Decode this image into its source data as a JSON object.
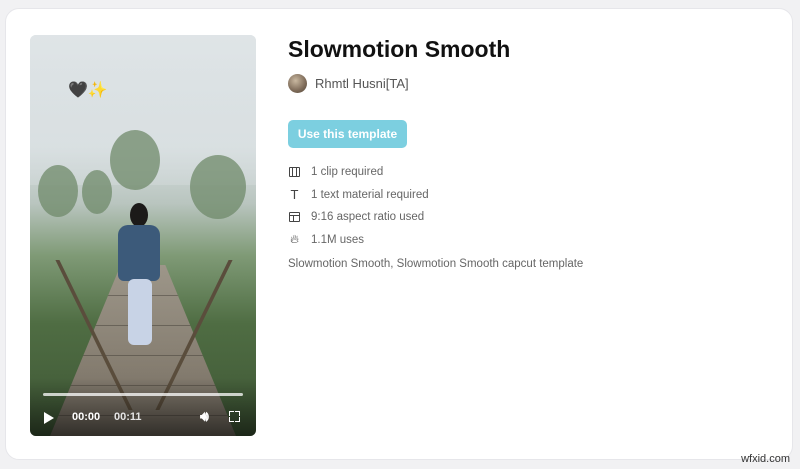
{
  "template": {
    "title": "Slowmotion Smooth",
    "author_name": "Rhmtl Husni[TA]",
    "use_button_label": "Use this template",
    "info": [
      {
        "icon": "film-icon",
        "text": "1 clip required"
      },
      {
        "icon": "text-icon",
        "text": "1 text material required"
      },
      {
        "icon": "aspect-ratio-icon",
        "text": "9:16 aspect ratio used"
      },
      {
        "icon": "flame-icon",
        "text": "1.1M uses"
      }
    ],
    "description": "Slowmotion Smooth, Slowmotion Smooth capcut template"
  },
  "video": {
    "overlay_text": "🖤✨",
    "current_time": "00:00",
    "duration": "00:11",
    "progress": 0
  },
  "watermark": "wfxid.com",
  "colors": {
    "accent_button": "#7ccfe0",
    "title": "#111111",
    "muted_text": "#666666"
  }
}
